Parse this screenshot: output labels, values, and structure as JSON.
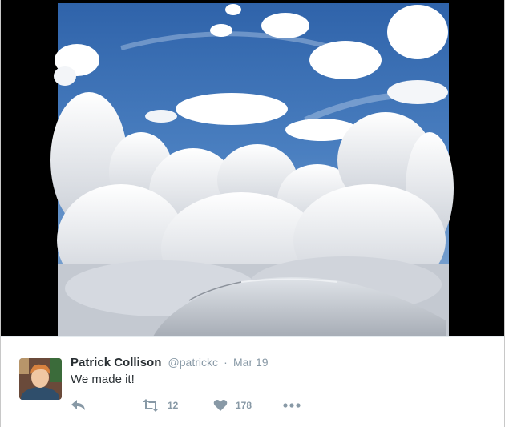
{
  "tweet": {
    "author_name": "Patrick Collison",
    "author_handle": "@patrickc",
    "separator": "·",
    "date": "Mar 19",
    "text": "We made it!"
  },
  "actions": {
    "reply_icon": "reply-icon",
    "retweet_icon": "retweet-icon",
    "retweet_count": "12",
    "like_icon": "heart-icon",
    "like_count": "178",
    "more_icon": "more-dots-icon"
  },
  "colors": {
    "sky": "#3f73b5",
    "media_background": "#000000",
    "muted_text": "#8899a6",
    "primary_text": "#292f33"
  }
}
